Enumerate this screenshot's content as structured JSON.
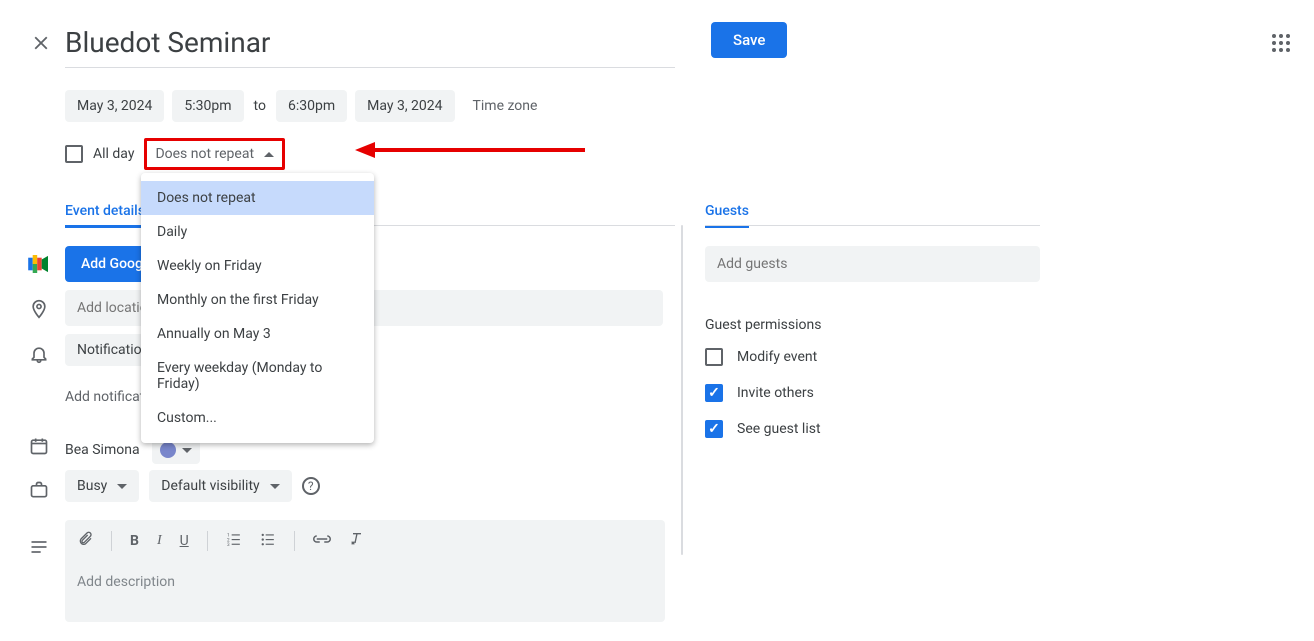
{
  "header": {
    "title_value": "Bluedot Seminar",
    "save_label": "Save"
  },
  "time": {
    "start_date": "May 3, 2024",
    "start_time": "5:30pm",
    "to_label": "to",
    "end_time": "6:30pm",
    "end_date": "May 3, 2024",
    "timezone_label": "Time zone"
  },
  "allday": {
    "label": "All day",
    "checked": false
  },
  "repeat": {
    "selected": "Does not repeat",
    "options": [
      "Does not repeat",
      "Daily",
      "Weekly on Friday",
      "Monthly on the first Friday",
      "Annually on May 3",
      "Every weekday (Monday to Friday)",
      "Custom..."
    ]
  },
  "tabs": {
    "event_details": "Event details",
    "guests": "Guests"
  },
  "conferencing": {
    "button_label": "Add Google Meet video conferencing"
  },
  "location": {
    "placeholder": "Add location"
  },
  "notification": {
    "type_label": "Notification",
    "add_label": "Add notification"
  },
  "organizer": {
    "name": "Bea Simona"
  },
  "availability": {
    "label": "Busy"
  },
  "visibility": {
    "label": "Default visibility"
  },
  "description": {
    "placeholder": "Add description"
  },
  "guests": {
    "input_placeholder": "Add guests",
    "permissions_title": "Guest permissions",
    "modify_event": {
      "label": "Modify event",
      "checked": false
    },
    "invite_others": {
      "label": "Invite others",
      "checked": true
    },
    "see_guest_list": {
      "label": "See guest list",
      "checked": true
    }
  }
}
